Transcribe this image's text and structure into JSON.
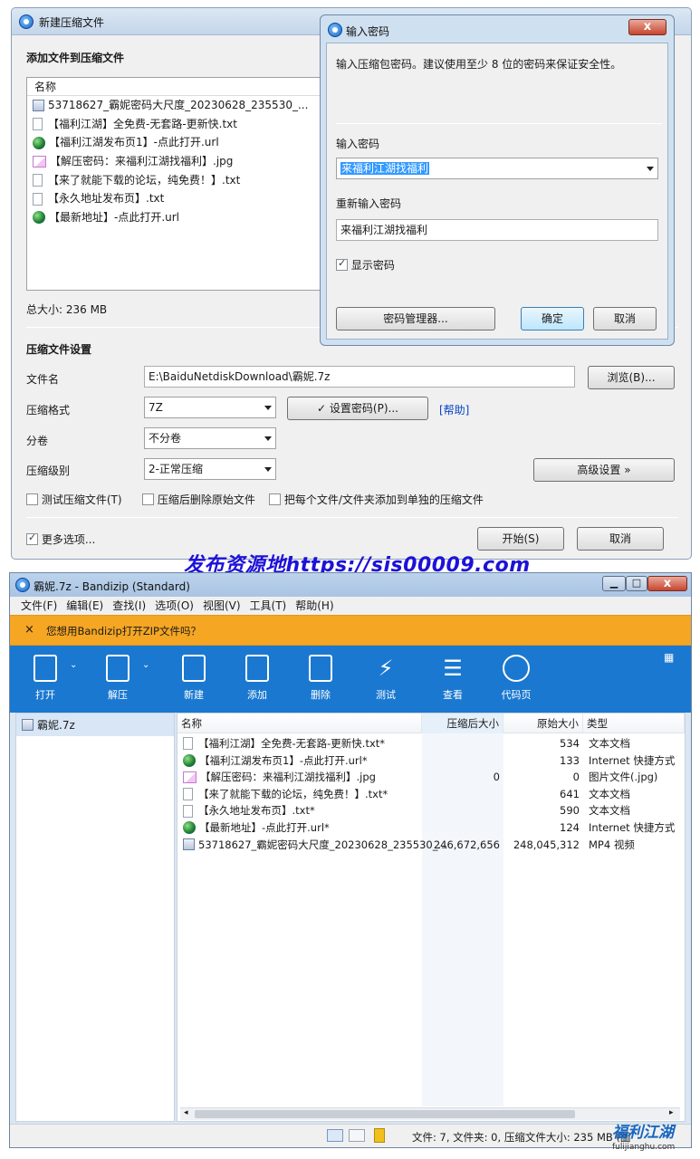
{
  "new_archive_dialog": {
    "title": "新建压缩文件",
    "add_files_heading": "添加文件到压缩文件",
    "list_header_name": "名称",
    "files": [
      {
        "name": "53718627_霸妮密码大尺度_20230628_235530_...",
        "icon": "video-file-icon"
      },
      {
        "name": "【福利江湖】全免费-无套路-更新快.txt",
        "icon": "text-file-icon"
      },
      {
        "name": "【福利江湖发布页1】-点此打开.url",
        "icon": "globe-icon"
      },
      {
        "name": "【解压密码：来福利江湖找福利】.jpg",
        "icon": "image-file-icon"
      },
      {
        "name": "【来了就能下载的论坛，纯免费！】.txt",
        "icon": "text-file-icon"
      },
      {
        "name": "【永久地址发布页】.txt",
        "icon": "text-file-icon"
      },
      {
        "name": "【最新地址】-点此打开.url",
        "icon": "globe-icon"
      }
    ],
    "total_size": "总大小: 236 MB",
    "settings_heading": "压缩文件设置",
    "filename_label": "文件名",
    "filename_value": "E:\\BaiduNetdiskDownload\\霸妮.7z",
    "browse_button": "浏览(B)...",
    "format_label": "压缩格式",
    "format_value": "7Z",
    "set_password_button": "✓ 设置密码(P)...",
    "help_link": "[帮助]",
    "split_label": "分卷",
    "split_value": "不分卷",
    "level_label": "压缩级别",
    "level_value": "2-正常压缩",
    "advanced_button": "高级设置 »",
    "test_archive_label": "测试压缩文件(T)",
    "delete_after_label": "压缩后删除原始文件",
    "each_separately_label": "把每个文件/文件夹添加到单独的压缩文件",
    "more_options_label": "更多选项...",
    "start_button": "开始(S)",
    "cancel_button": "取消"
  },
  "password_dialog": {
    "title": "输入密码",
    "close_glyph": "x",
    "description": "输入压缩包密码。建议使用至少 8 位的密码来保证安全性。",
    "enter_label": "输入密码",
    "password_value": "来福利江湖找福利",
    "reenter_label": "重新输入密码",
    "reenter_value": "来福利江湖找福利",
    "show_password_label": "显示密码",
    "manager_button": "密码管理器...",
    "ok_button": "确定",
    "cancel_button": "取消"
  },
  "watermark": "发布资源地https://sis00009.com",
  "bandizip": {
    "title": "霸妮.7z - Bandizip (Standard)",
    "menu": [
      "文件(F)",
      "编辑(E)",
      "查找(I)",
      "选项(O)",
      "视图(V)",
      "工具(T)",
      "帮助(H)"
    ],
    "notice_close": "×",
    "notice_text": "您想用Bandizip打开ZIP文件吗？",
    "toolbar": [
      "打开",
      "解压",
      "新建",
      "添加",
      "删除",
      "测试",
      "查看",
      "代码页"
    ],
    "tree_item": "霸妮.7z",
    "columns": [
      "名称",
      "压缩后大小",
      "原始大小",
      "类型"
    ],
    "rows": [
      {
        "name": "【福利江湖】全免费-无套路-更新快.txt*",
        "packed": "",
        "size": "534",
        "type": "文本文档",
        "icon": "text-file-icon"
      },
      {
        "name": "【福利江湖发布页1】-点此打开.url*",
        "packed": "",
        "size": "133",
        "type": "Internet 快捷方式",
        "icon": "globe-icon"
      },
      {
        "name": "【解压密码：来福利江湖找福利】.jpg",
        "packed": "0",
        "size": "0",
        "type": "图片文件(.jpg)",
        "icon": "image-file-icon"
      },
      {
        "name": "【来了就能下载的论坛，纯免费！】.txt*",
        "packed": "",
        "size": "641",
        "type": "文本文档",
        "icon": "text-file-icon"
      },
      {
        "name": "【永久地址发布页】.txt*",
        "packed": "",
        "size": "590",
        "type": "文本文档",
        "icon": "text-file-icon"
      },
      {
        "name": "【最新地址】-点此打开.url*",
        "packed": "",
        "size": "124",
        "type": "Internet 快捷方式",
        "icon": "globe-icon"
      },
      {
        "name": "53718627_霸妮密码大尺度_20230628_235530_...",
        "packed": "246,672,656",
        "size": "248,045,312",
        "type": "MP4 视频",
        "icon": "video-file-icon"
      }
    ],
    "status": "文件: 7, 文件夹: 0, 压缩文件大小: 235 MB (圖",
    "logo_text": "福利江湖",
    "logo_url": "fulijianghu.com"
  },
  "colors": {
    "toolbar_blue": "#1a78d0",
    "notice_orange": "#f5a623",
    "watermark_blue": "#1d12d8",
    "link_blue": "#0645c6"
  }
}
